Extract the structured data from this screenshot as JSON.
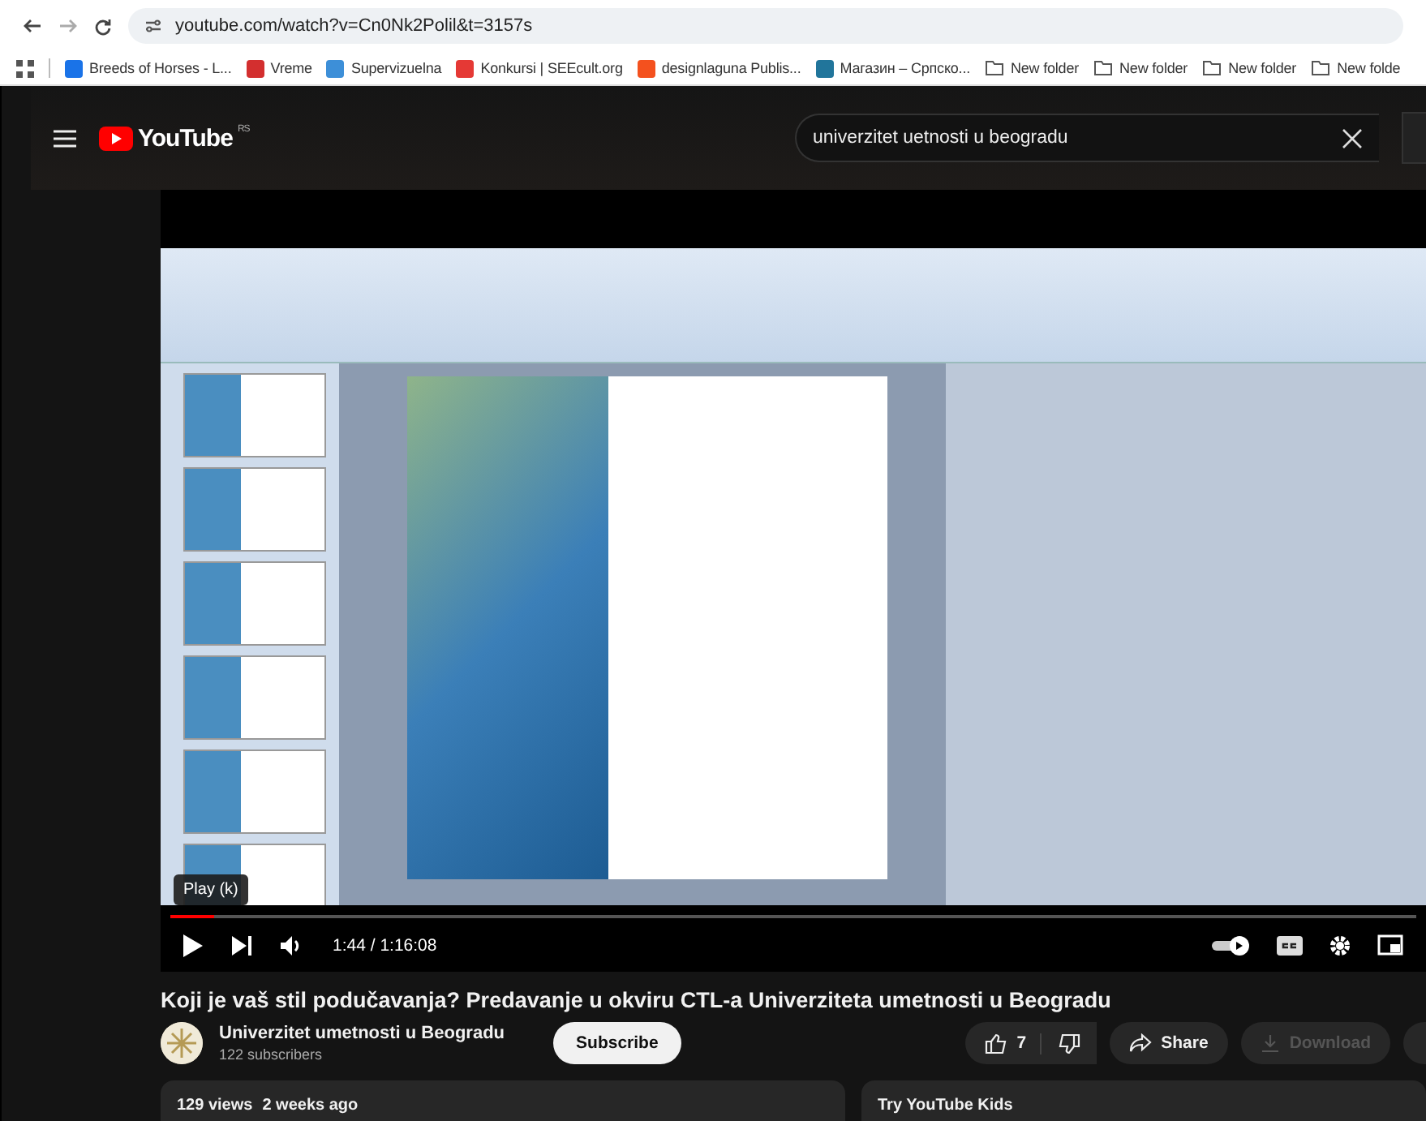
{
  "browser": {
    "url": "youtube.com/watch?v=Cn0Nk2Polil&t=3157s",
    "bookmarks": [
      {
        "kind": "site",
        "label": "Breeds of Horses - L...",
        "color": "#1a73e8"
      },
      {
        "kind": "site",
        "label": "Vreme",
        "color": "#d32f2f"
      },
      {
        "kind": "site",
        "label": "Supervizuelna",
        "color": "#3d8fd8"
      },
      {
        "kind": "site",
        "label": "Konkursi | SEEcult.org",
        "color": "#e53935"
      },
      {
        "kind": "site",
        "label": "designlaguna Publis...",
        "color": "#f4511e"
      },
      {
        "kind": "site",
        "label": "Магазин – Српско...",
        "color": "#21759b"
      },
      {
        "kind": "folder",
        "label": "New folder"
      },
      {
        "kind": "folder",
        "label": "New folder"
      },
      {
        "kind": "folder",
        "label": "New folder"
      },
      {
        "kind": "folder",
        "label": "New folde"
      }
    ]
  },
  "header": {
    "logo": "YouTube",
    "region": "RS",
    "search": {
      "value": "univerzitet uetnosti u beogradu"
    }
  },
  "player": {
    "tooltip": "Play (k)",
    "time": "1:44 / 1:16:08",
    "progress": {
      "level": 0.035
    },
    "autoplay": {
      "on": true
    }
  },
  "video": {
    "title": "Koji je vaš stil podučavanja? Predavanje u okviru CTL-a Univerziteta umetnosti u Beogradu",
    "channel": {
      "name": "Univerzitet umetnosti u Beogradu",
      "subscribers": "122 subscribers"
    },
    "subscribe": "Subscribe",
    "likes": "7",
    "actions": [
      {
        "kind": "share",
        "label": "Share",
        "disabled": false
      },
      {
        "kind": "download",
        "label": "Download",
        "disabled": true
      }
    ]
  },
  "description": {
    "views": "129 views",
    "age": "2 weeks ago"
  },
  "side_card": {
    "title": "Try YouTube Kids"
  }
}
